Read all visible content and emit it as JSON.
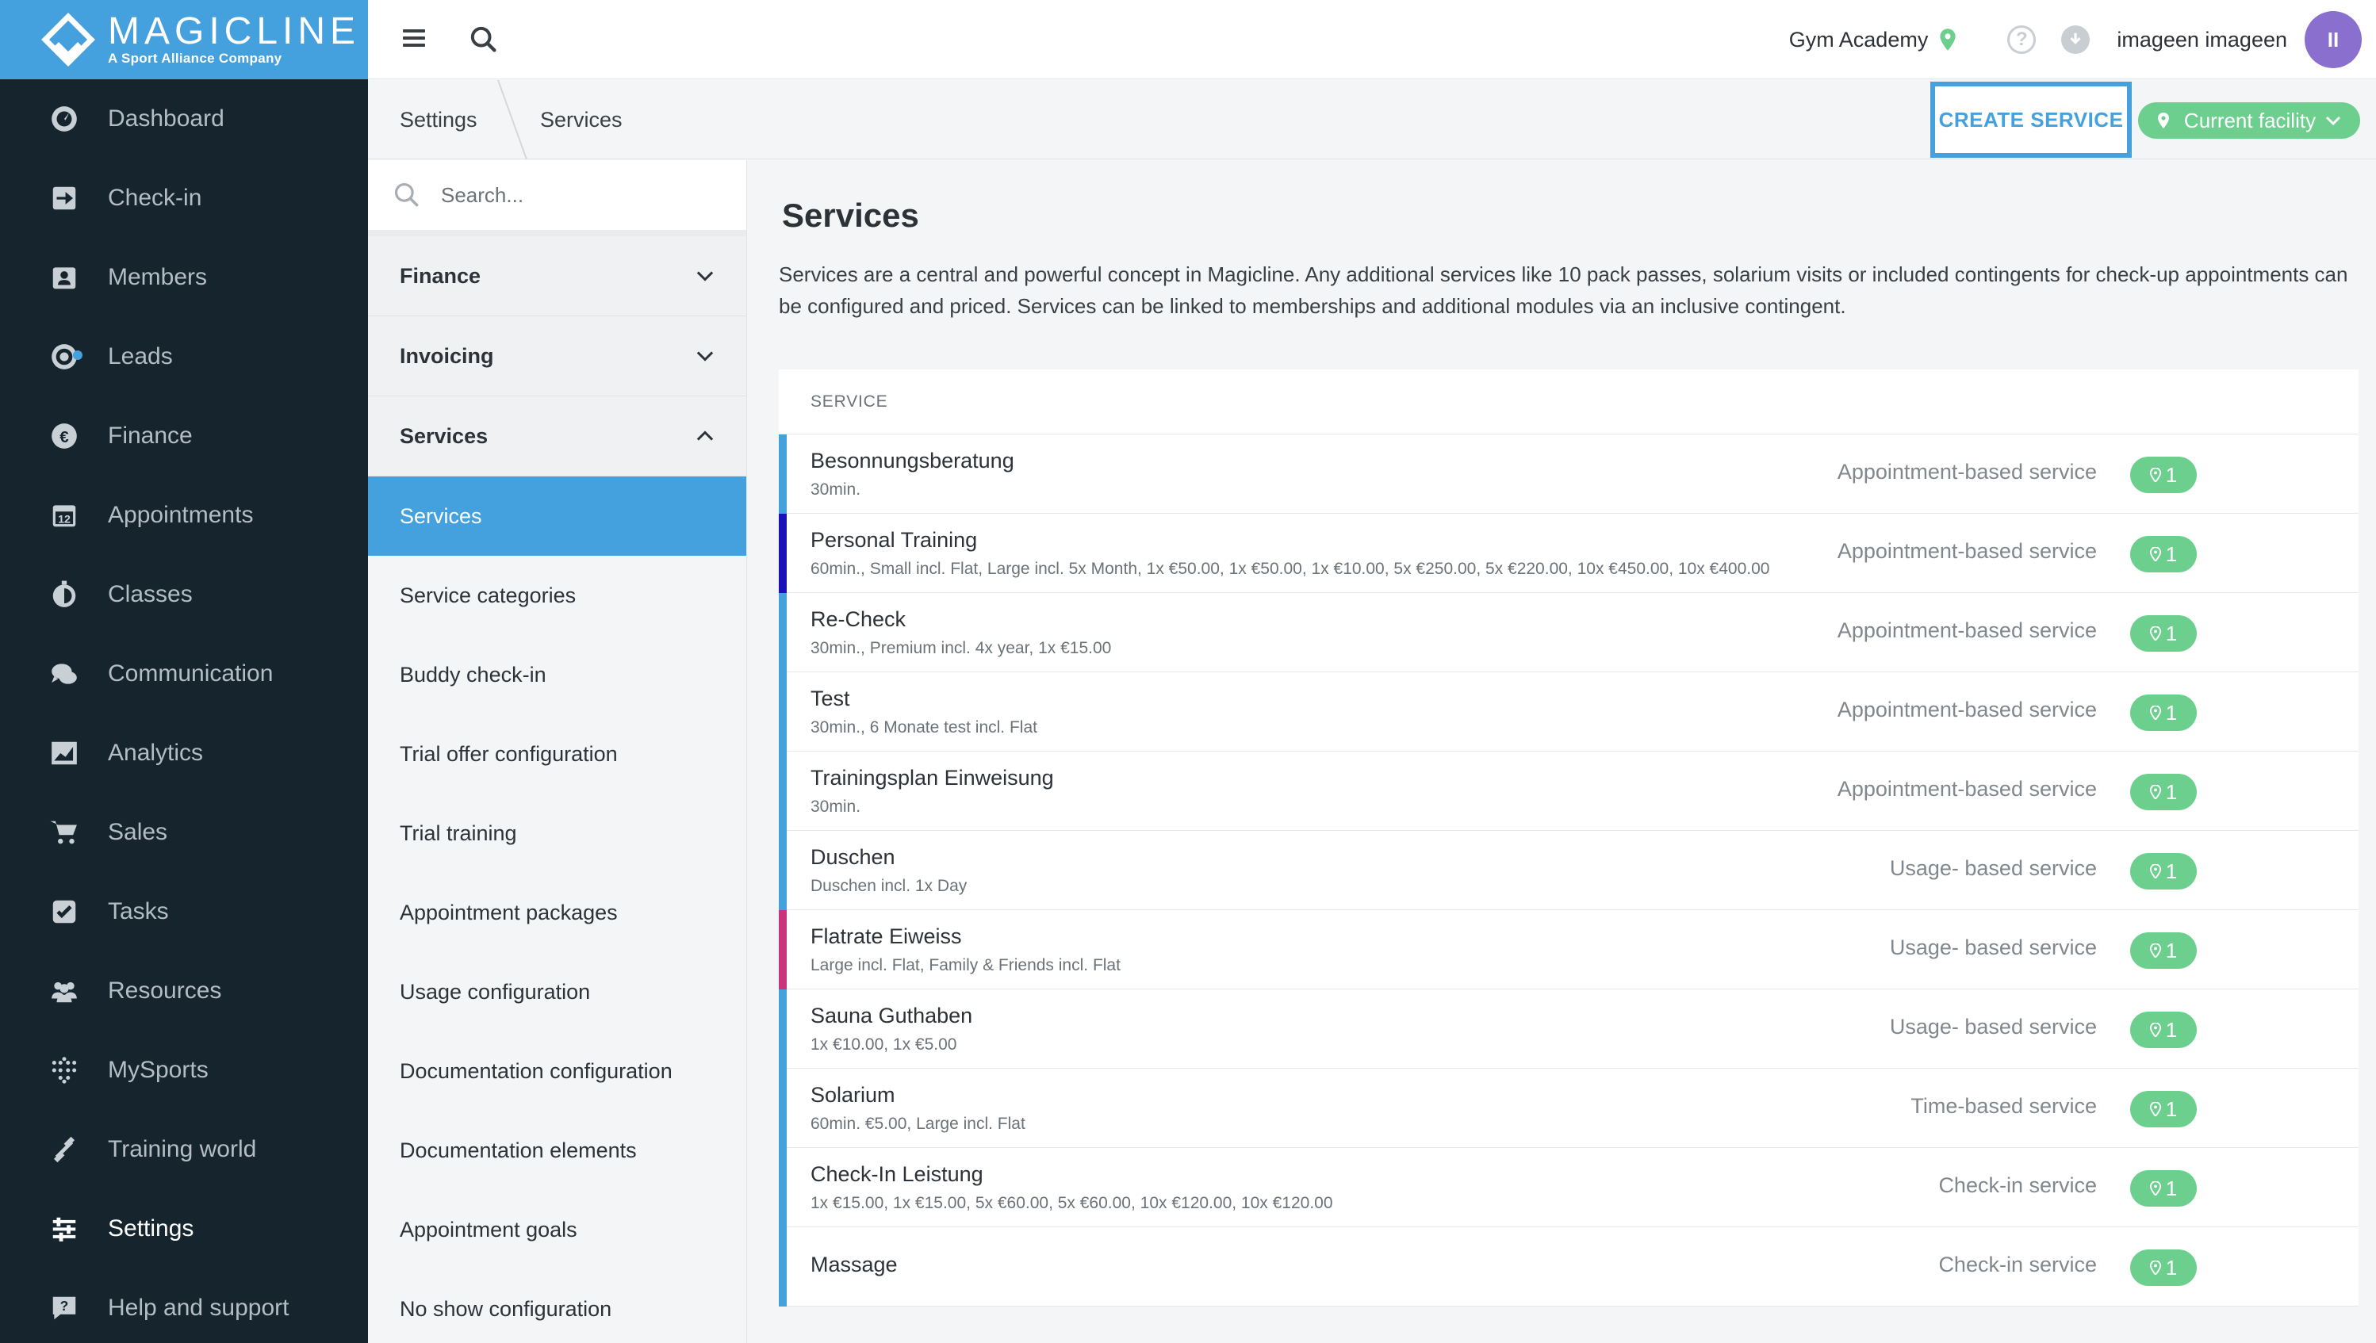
{
  "brand": {
    "name": "MAGICLINE",
    "tagline": "A Sport Alliance Company"
  },
  "nav": {
    "items": [
      {
        "label": "Dashboard",
        "icon": "dashboard-icon"
      },
      {
        "label": "Check-in",
        "icon": "check-in-icon"
      },
      {
        "label": "Members",
        "icon": "members-icon"
      },
      {
        "label": "Leads",
        "icon": "leads-icon"
      },
      {
        "label": "Finance",
        "icon": "finance-icon"
      },
      {
        "label": "Appointments",
        "icon": "calendar-icon"
      },
      {
        "label": "Classes",
        "icon": "stopwatch-icon"
      },
      {
        "label": "Communication",
        "icon": "chat-icon"
      },
      {
        "label": "Analytics",
        "icon": "chart-icon"
      },
      {
        "label": "Sales",
        "icon": "cart-icon"
      },
      {
        "label": "Tasks",
        "icon": "checkbox-icon"
      },
      {
        "label": "Resources",
        "icon": "people-icon"
      },
      {
        "label": "MySports",
        "icon": "grid-icon"
      },
      {
        "label": "Training world",
        "icon": "dumbbell-icon"
      },
      {
        "label": "Settings",
        "icon": "sliders-icon"
      },
      {
        "label": "Help and support",
        "icon": "help-chat-icon"
      }
    ],
    "active": "Settings"
  },
  "topbar": {
    "facility": "Gym Academy",
    "user": "imageen imageen",
    "avatar_initials": "II"
  },
  "breadcrumb": {
    "items": [
      "Settings",
      "Services"
    ]
  },
  "actions": {
    "create": "CREATE SERVICE",
    "facility_filter": "Current facility"
  },
  "subnav": {
    "search_placeholder": "Search...",
    "groups": [
      {
        "label": "Finance",
        "expanded": false
      },
      {
        "label": "Invoicing",
        "expanded": false
      },
      {
        "label": "Services",
        "expanded": true
      }
    ],
    "items": [
      "Services",
      "Service categories",
      "Buddy check-in",
      "Trial offer configuration",
      "Trial training",
      "Appointment packages",
      "Usage configuration",
      "Documentation configuration",
      "Documentation elements",
      "Appointment goals",
      "No show configuration"
    ],
    "active_item": "Services"
  },
  "main": {
    "title": "Services",
    "description": "Services are a central and powerful concept in Magicline. Any additional services like 10 pack passes, solarium visits or included contingents for check-up appointments can be configured and priced. Services can be linked to memberships and additional modules via an inclusive contingent.",
    "table_header": "SERVICE",
    "rows": [
      {
        "name": "Besonnungsberatung",
        "details": "30min.",
        "type": "Appointment-based service",
        "facilities": "1",
        "color": "#45a1de"
      },
      {
        "name": "Personal Training",
        "details": "60min., Small incl. Flat, Large incl. 5x Month, 1x €50.00, 1x €50.00, 1x €10.00, 5x €250.00, 5x €220.00, 10x €450.00, 10x €400.00",
        "type": "Appointment-based service",
        "facilities": "1",
        "color": "#1a12b8"
      },
      {
        "name": "Re-Check",
        "details": "30min., Premium incl. 4x year, 1x €15.00",
        "type": "Appointment-based service",
        "facilities": "1",
        "color": "#45a1de"
      },
      {
        "name": "Test",
        "details": "30min., 6 Monate test incl. Flat",
        "type": "Appointment-based service",
        "facilities": "1",
        "color": "#45a1de"
      },
      {
        "name": "Trainingsplan Einweisung",
        "details": "30min.",
        "type": "Appointment-based service",
        "facilities": "1",
        "color": "#45a1de"
      },
      {
        "name": "Duschen",
        "details": "Duschen incl. 1x Day",
        "type": "Usage- based service",
        "facilities": "1",
        "color": "#45a1de"
      },
      {
        "name": "Flatrate Eiweiss",
        "details": "Large incl. Flat, Family & Friends incl. Flat",
        "type": "Usage- based service",
        "facilities": "1",
        "color": "#c8357a"
      },
      {
        "name": "Sauna Guthaben",
        "details": "1x €10.00, 1x €5.00",
        "type": "Usage- based service",
        "facilities": "1",
        "color": "#45a1de"
      },
      {
        "name": "Solarium",
        "details": "60min. €5.00, Large incl. Flat",
        "type": "Time-based service",
        "facilities": "1",
        "color": "#45a1de"
      },
      {
        "name": "Check-In Leistung",
        "details": "1x €15.00, 1x €15.00, 5x €60.00, 5x €60.00, 10x €120.00, 10x €120.00",
        "type": "Check-in service",
        "facilities": "1",
        "color": "#45a1de"
      },
      {
        "name": "Massage",
        "details": "",
        "type": "Check-in service",
        "facilities": "1",
        "color": "#45a1de"
      }
    ]
  },
  "colors": {
    "accent": "#45a1de",
    "nav_bg": "#16242e",
    "success": "#6ccf8e",
    "avatar": "#8a6fce"
  }
}
